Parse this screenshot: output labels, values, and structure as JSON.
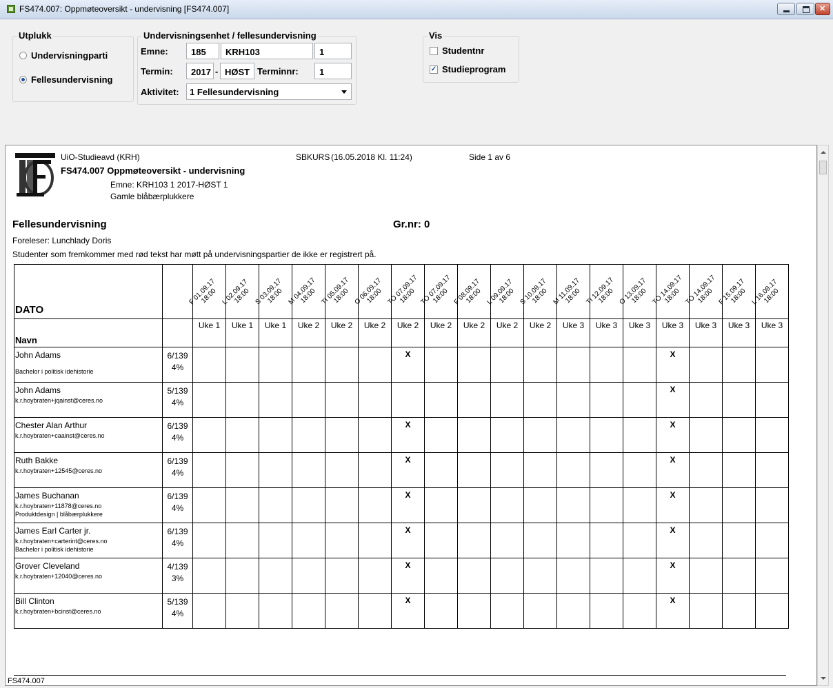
{
  "window": {
    "title": "FS474.007: Oppmøteoversikt - undervisning  [FS474.007]"
  },
  "utplukk": {
    "label": "Utplukk",
    "option1": "Undervisningparti",
    "option2": "Fellesundervisning",
    "selected": "Fellesundervisning"
  },
  "unit": {
    "label": "Undervisningsenhet / fellesundervisning",
    "emne_label": "Emne:",
    "emne_inst": "185",
    "emne_code": "KRH103",
    "emne_version": "1",
    "termin_label": "Termin:",
    "termin_year": "2017",
    "termin_dash": "-",
    "termin_season": "HØST",
    "terminnr_label": "Terminnr:",
    "terminnr": "1",
    "aktivitet_label": "Aktivitet:",
    "aktivitet_value": "1 Fellesundervisning"
  },
  "vis": {
    "label": "Vis",
    "studentnr": "Studentnr",
    "studentnr_checked": false,
    "studieprogram": "Studieprogram",
    "studieprogram_checked": true
  },
  "report": {
    "institution": "UiO-Studieavd (KRH)",
    "system": "SBKURS",
    "timestamp": "(16.05.2018 Kl. 11:24)",
    "page": "Side 1 av 6",
    "title": "FS474.007 Oppmøteoversikt - undervisning",
    "emne_line": "Emne: KRH103 1 2017-HØST 1",
    "group_line": "Gamle blåbærplukkere",
    "section": "Fellesundervisning",
    "grnr": "Gr.nr: 0",
    "foreleser": "Foreleser:  Lunchlady Doris",
    "note": "Studenter som fremkommer med rød tekst har møtt på undervisningspartier de ikke er registrert på.",
    "footer": "FS474.007",
    "col_dato": "DATO",
    "col_navn": "Navn",
    "dates": [
      {
        "label": "F 01.09.17",
        "time": "18:00",
        "week": "Uke 1"
      },
      {
        "label": "L 02.09.17",
        "time": "18:00",
        "week": "Uke 1"
      },
      {
        "label": "S 03.09.17",
        "time": "18:00",
        "week": "Uke 1"
      },
      {
        "label": "M 04.09.17",
        "time": "18:00",
        "week": "Uke 2"
      },
      {
        "label": "TI 05.09.17",
        "time": "18:00",
        "week": "Uke 2"
      },
      {
        "label": "O 06.09.17",
        "time": "18:00",
        "week": "Uke 2"
      },
      {
        "label": "TO 07.09.17",
        "time": "18:00",
        "week": "Uke 2"
      },
      {
        "label": "TO 07.09.17",
        "time": "18:00",
        "week": "Uke 2"
      },
      {
        "label": "F 08.09.17",
        "time": "18:00",
        "week": "Uke 2"
      },
      {
        "label": "L 09.09.17",
        "time": "18:00",
        "week": "Uke 2"
      },
      {
        "label": "S 10.09.17",
        "time": "18:00",
        "week": "Uke 2"
      },
      {
        "label": "M 11.09.17",
        "time": "18:00",
        "week": "Uke 3"
      },
      {
        "label": "TI 12.09.17",
        "time": "18:00",
        "week": "Uke 3"
      },
      {
        "label": "O 13.09.17",
        "time": "18:00",
        "week": "Uke 3"
      },
      {
        "label": "TO 14.09.17",
        "time": "18:00",
        "week": "Uke 3"
      },
      {
        "label": "TO 14.09.17",
        "time": "18:00",
        "week": "Uke 3"
      },
      {
        "label": "F 15.09.17",
        "time": "18:00",
        "week": "Uke 3"
      },
      {
        "label": "L 16.09.17",
        "time": "18:00",
        "week": "Uke 3"
      }
    ],
    "students": [
      {
        "name": "John Adams",
        "sub1": "",
        "sub2": "Bachelor i politisk idehistorie",
        "count": "6/139",
        "pct": "4%",
        "marks": [
          6,
          14
        ]
      },
      {
        "name": "John Adams",
        "sub1": "k.r.hoybraten+jqainst@ceres.no",
        "sub2": "",
        "count": "5/139",
        "pct": "4%",
        "marks": [
          14
        ]
      },
      {
        "name": "Chester Alan Arthur",
        "sub1": "k.r.hoybraten+caainst@ceres.no",
        "sub2": "",
        "count": "6/139",
        "pct": "4%",
        "marks": [
          6,
          14
        ]
      },
      {
        "name": "Ruth Bakke",
        "sub1": "k.r.hoybraten+12545@ceres.no",
        "sub2": "",
        "count": "6/139",
        "pct": "4%",
        "marks": [
          6,
          14
        ]
      },
      {
        "name": "James Buchanan",
        "sub1": "k.r.hoybraten+11878@ceres.no",
        "sub2": "Produktdesign | blåbærplukkere",
        "count": "6/139",
        "pct": "4%",
        "marks": [
          6,
          14
        ]
      },
      {
        "name": "James Earl Carter jr.",
        "sub1": "k.r.hoybraten+carterint@ceres.no",
        "sub2": "Bachelor i politisk idehistorie",
        "count": "6/139",
        "pct": "4%",
        "marks": [
          6,
          14
        ]
      },
      {
        "name": "Grover Cleveland",
        "sub1": "k.r.hoybraten+12040@ceres.no",
        "sub2": "",
        "count": "4/139",
        "pct": "3%",
        "marks": [
          6,
          14
        ]
      },
      {
        "name": "Bill Clinton",
        "sub1": "k.r.hoybraten+bcinst@ceres.no",
        "sub2": "",
        "count": "5/139",
        "pct": "4%",
        "marks": [
          6,
          14
        ]
      }
    ],
    "mark_symbol": "X"
  }
}
